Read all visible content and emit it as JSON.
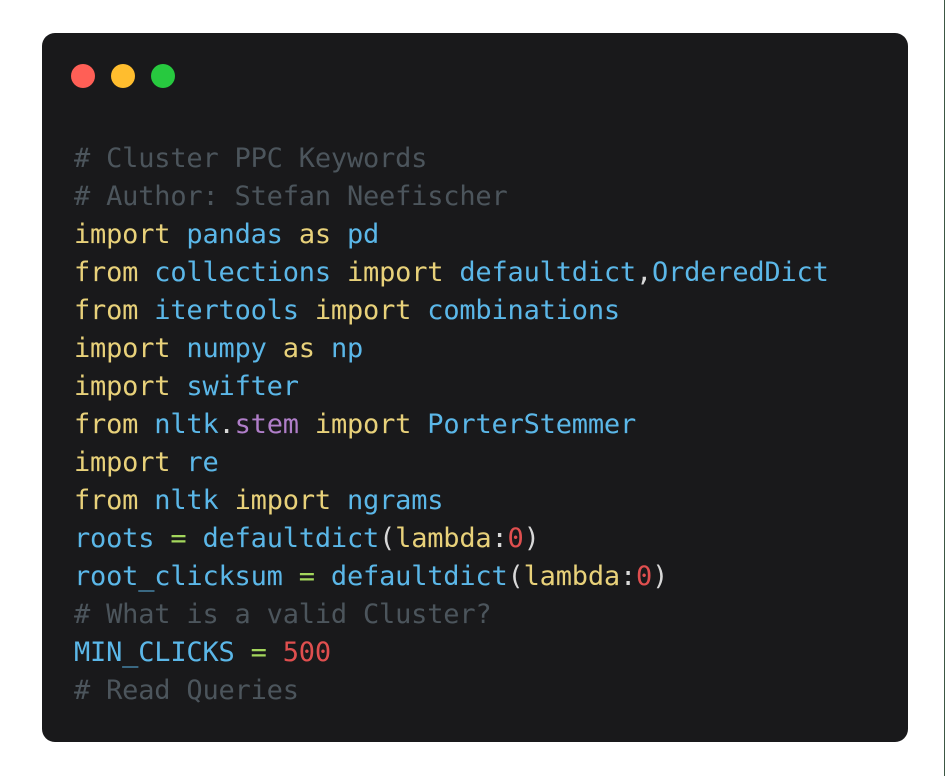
{
  "window": {
    "dots": [
      {
        "name": "close",
        "color": "#ff5f56"
      },
      {
        "name": "minimize",
        "color": "#ffbd2e"
      },
      {
        "name": "maximize",
        "color": "#27c93f"
      }
    ]
  },
  "palette": {
    "page_background": "#ffffff",
    "card_background": "#19191b",
    "comment": "#4c555c",
    "keyword": "#e8d17a",
    "module": "#5bb7e8",
    "identifier": "#5bb7e8",
    "attribute": "#b07ec9",
    "operator": "#a3d65c",
    "number": "#e04f4f",
    "punctuation": "#d8d8d8",
    "right_rule": "#3c5744"
  },
  "code": {
    "language": "python",
    "plain_text": "# Cluster PPC Keywords\n# Author: Stefan Neefischer\nimport pandas as pd\nfrom collections import defaultdict,OrderedDict\nfrom itertools import combinations\nimport numpy as np\nimport swifter\nfrom nltk.stem import PorterStemmer\nimport re\nfrom nltk import ngrams\nroots = defaultdict(lambda:0)\nroot_clicksum = defaultdict(lambda:0)\n# What is a valid Cluster?\nMIN_CLICKS = 500\n# Read Queries",
    "lines": [
      {
        "n": 1,
        "tokens": [
          {
            "t": "# Cluster PPC Keywords",
            "c": "com"
          }
        ]
      },
      {
        "n": 2,
        "tokens": [
          {
            "t": "# Author: Stefan Neefischer",
            "c": "com"
          }
        ]
      },
      {
        "n": 3,
        "tokens": [
          {
            "t": "import",
            "c": "kw"
          },
          {
            "t": " ",
            "c": "pun"
          },
          {
            "t": "pandas",
            "c": "mod"
          },
          {
            "t": " ",
            "c": "pun"
          },
          {
            "t": "as",
            "c": "kw"
          },
          {
            "t": " ",
            "c": "pun"
          },
          {
            "t": "pd",
            "c": "mod"
          }
        ]
      },
      {
        "n": 4,
        "tokens": [
          {
            "t": "from",
            "c": "kw"
          },
          {
            "t": " ",
            "c": "pun"
          },
          {
            "t": "collections",
            "c": "mod"
          },
          {
            "t": " ",
            "c": "pun"
          },
          {
            "t": "import",
            "c": "kw"
          },
          {
            "t": " ",
            "c": "pun"
          },
          {
            "t": "defaultdict",
            "c": "mod"
          },
          {
            "t": ",",
            "c": "pun"
          },
          {
            "t": "OrderedDict",
            "c": "mod"
          }
        ]
      },
      {
        "n": 5,
        "tokens": [
          {
            "t": "from",
            "c": "kw"
          },
          {
            "t": " ",
            "c": "pun"
          },
          {
            "t": "itertools",
            "c": "mod"
          },
          {
            "t": " ",
            "c": "pun"
          },
          {
            "t": "import",
            "c": "kw"
          },
          {
            "t": " ",
            "c": "pun"
          },
          {
            "t": "combinations",
            "c": "mod"
          }
        ]
      },
      {
        "n": 6,
        "tokens": [
          {
            "t": "import",
            "c": "kw"
          },
          {
            "t": " ",
            "c": "pun"
          },
          {
            "t": "numpy",
            "c": "mod"
          },
          {
            "t": " ",
            "c": "pun"
          },
          {
            "t": "as",
            "c": "kw"
          },
          {
            "t": " ",
            "c": "pun"
          },
          {
            "t": "np",
            "c": "mod"
          }
        ]
      },
      {
        "n": 7,
        "tokens": [
          {
            "t": "import",
            "c": "kw"
          },
          {
            "t": " ",
            "c": "pun"
          },
          {
            "t": "swifter",
            "c": "mod"
          }
        ]
      },
      {
        "n": 8,
        "tokens": [
          {
            "t": "from",
            "c": "kw"
          },
          {
            "t": " ",
            "c": "pun"
          },
          {
            "t": "nltk",
            "c": "mod"
          },
          {
            "t": ".",
            "c": "pun"
          },
          {
            "t": "stem",
            "c": "attr"
          },
          {
            "t": " ",
            "c": "pun"
          },
          {
            "t": "import",
            "c": "kw"
          },
          {
            "t": " ",
            "c": "pun"
          },
          {
            "t": "PorterStemmer",
            "c": "mod"
          }
        ]
      },
      {
        "n": 9,
        "tokens": [
          {
            "t": "import",
            "c": "kw"
          },
          {
            "t": " ",
            "c": "pun"
          },
          {
            "t": "re",
            "c": "mod"
          }
        ]
      },
      {
        "n": 10,
        "tokens": [
          {
            "t": "from",
            "c": "kw"
          },
          {
            "t": " ",
            "c": "pun"
          },
          {
            "t": "nltk",
            "c": "mod"
          },
          {
            "t": " ",
            "c": "pun"
          },
          {
            "t": "import",
            "c": "kw"
          },
          {
            "t": " ",
            "c": "pun"
          },
          {
            "t": "ngrams",
            "c": "mod"
          }
        ]
      },
      {
        "n": 11,
        "tokens": [
          {
            "t": "roots",
            "c": "name"
          },
          {
            "t": " ",
            "c": "pun"
          },
          {
            "t": "=",
            "c": "op"
          },
          {
            "t": " ",
            "c": "pun"
          },
          {
            "t": "defaultdict",
            "c": "name"
          },
          {
            "t": "(",
            "c": "pun"
          },
          {
            "t": "lambda",
            "c": "kw"
          },
          {
            "t": ":",
            "c": "pun"
          },
          {
            "t": "0",
            "c": "num"
          },
          {
            "t": ")",
            "c": "pun"
          }
        ]
      },
      {
        "n": 12,
        "tokens": [
          {
            "t": "root_clicksum",
            "c": "name"
          },
          {
            "t": " ",
            "c": "pun"
          },
          {
            "t": "=",
            "c": "op"
          },
          {
            "t": " ",
            "c": "pun"
          },
          {
            "t": "defaultdict",
            "c": "name"
          },
          {
            "t": "(",
            "c": "pun"
          },
          {
            "t": "lambda",
            "c": "kw"
          },
          {
            "t": ":",
            "c": "pun"
          },
          {
            "t": "0",
            "c": "num"
          },
          {
            "t": ")",
            "c": "pun"
          }
        ]
      },
      {
        "n": 13,
        "tokens": [
          {
            "t": "# What is a valid Cluster?",
            "c": "com"
          }
        ]
      },
      {
        "n": 14,
        "tokens": [
          {
            "t": "MIN_CLICKS",
            "c": "name"
          },
          {
            "t": " ",
            "c": "pun"
          },
          {
            "t": "=",
            "c": "op"
          },
          {
            "t": " ",
            "c": "pun"
          },
          {
            "t": "500",
            "c": "num"
          }
        ]
      },
      {
        "n": 15,
        "tokens": [
          {
            "t": "# Read Queries",
            "c": "com"
          }
        ]
      }
    ]
  }
}
